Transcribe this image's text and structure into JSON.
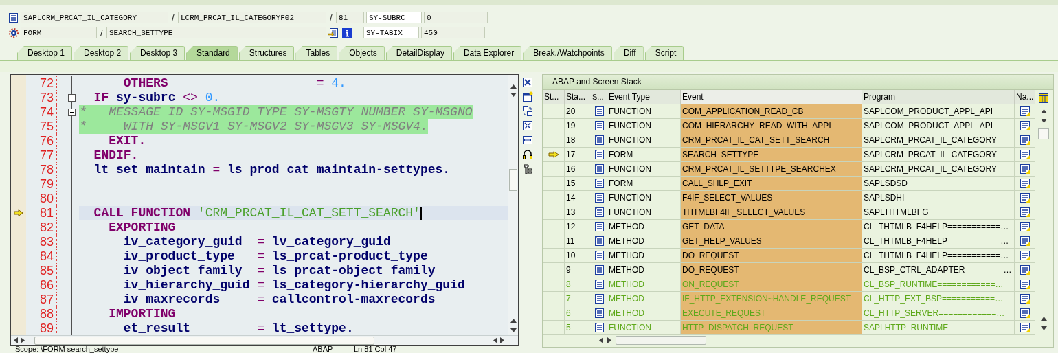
{
  "header": {
    "row1": {
      "program": "SAPLCRM_PRCAT_IL_CATEGORY",
      "separator_1": "/",
      "include": "LCRM_PRCAT_IL_CATEGORYF02",
      "separator_2": "/",
      "line": "81",
      "var_name": "SY-SUBRC",
      "var_value": "0"
    },
    "row2": {
      "event_type": "FORM",
      "separator": "/",
      "event": "SEARCH_SETTYPE",
      "var_name": "SY-TABIX",
      "var_value": "450"
    }
  },
  "tabs": [
    {
      "label": "Desktop 1",
      "selected": false
    },
    {
      "label": "Desktop 2",
      "selected": false
    },
    {
      "label": "Desktop 3",
      "selected": false
    },
    {
      "label": "Standard",
      "selected": true
    },
    {
      "label": "Structures",
      "selected": false
    },
    {
      "label": "Tables",
      "selected": false
    },
    {
      "label": "Objects",
      "selected": false
    },
    {
      "label": "DetailDisplay",
      "selected": false
    },
    {
      "label": "Data Explorer",
      "selected": false
    },
    {
      "label": "Break./Watchpoints",
      "selected": false
    },
    {
      "label": "Diff",
      "selected": false
    },
    {
      "label": "Script",
      "selected": false
    }
  ],
  "editor": {
    "lines": [
      {
        "number": "72",
        "current": false,
        "fold": false,
        "segments": [
          {
            "kind": "kw",
            "text": "      OTHERS"
          },
          {
            "kind": "op",
            "text": "                    = "
          },
          {
            "kind": "num",
            "text": "4."
          }
        ]
      },
      {
        "number": "73",
        "current": false,
        "fold": true,
        "segments": [
          {
            "kind": "kw",
            "text": "  IF"
          },
          {
            "kind": "id",
            "text": " sy-subrc"
          },
          {
            "kind": "op",
            "text": " <> "
          },
          {
            "kind": "num",
            "text": "0."
          }
        ]
      },
      {
        "number": "74",
        "current": false,
        "fold": true,
        "segments": [
          {
            "kind": "cmt",
            "text": "*   MESSAGE ID SY-MSGID TYPE SY-MSGTY NUMBER SY-MSGNO"
          }
        ]
      },
      {
        "number": "75",
        "current": false,
        "fold": false,
        "segments": [
          {
            "kind": "cmt",
            "text": "*     WITH SY-MSGV1 SY-MSGV2 SY-MSGV3 SY-MSGV4."
          }
        ]
      },
      {
        "number": "76",
        "current": false,
        "fold": false,
        "segments": [
          {
            "kind": "kw",
            "text": "    EXIT."
          }
        ]
      },
      {
        "number": "77",
        "current": false,
        "fold": false,
        "segments": [
          {
            "kind": "kw",
            "text": "  ENDIF."
          }
        ]
      },
      {
        "number": "78",
        "current": false,
        "fold": false,
        "segments": [
          {
            "kind": "id",
            "text": "  lt_set_maintain"
          },
          {
            "kind": "op",
            "text": " = "
          },
          {
            "kind": "id",
            "text": "ls_prod_cat_maintain-settypes."
          }
        ]
      },
      {
        "number": "79",
        "current": false,
        "fold": false
      },
      {
        "number": "80",
        "current": false,
        "fold": false
      },
      {
        "number": "81",
        "current": true,
        "fold": false,
        "segments": [
          {
            "kind": "kw",
            "text": "  CALL FUNCTION"
          },
          {
            "kind": "str",
            "text": " 'CRM_PRCAT_IL_CAT_SETT_SEARCH'"
          }
        ]
      },
      {
        "number": "82",
        "current": false,
        "fold": false,
        "segments": [
          {
            "kind": "kw",
            "text": "    EXPORTING"
          }
        ]
      },
      {
        "number": "83",
        "current": false,
        "fold": false,
        "segments": [
          {
            "kind": "id",
            "text": "      iv_category_guid"
          },
          {
            "kind": "op",
            "text": "  = "
          },
          {
            "kind": "id",
            "text": "lv_category_guid"
          }
        ]
      },
      {
        "number": "84",
        "current": false,
        "fold": false,
        "segments": [
          {
            "kind": "id",
            "text": "      iv_product_type"
          },
          {
            "kind": "op",
            "text": "   = "
          },
          {
            "kind": "id",
            "text": "ls_prcat-product_type"
          }
        ]
      },
      {
        "number": "85",
        "current": false,
        "fold": false,
        "segments": [
          {
            "kind": "id",
            "text": "      iv_object_family"
          },
          {
            "kind": "op",
            "text": "  = "
          },
          {
            "kind": "id",
            "text": "ls_prcat-object_family"
          }
        ]
      },
      {
        "number": "86",
        "current": false,
        "fold": false,
        "segments": [
          {
            "kind": "id",
            "text": "      iv_hierarchy_guid"
          },
          {
            "kind": "op",
            "text": " = "
          },
          {
            "kind": "id",
            "text": "ls_category-hierarchy_guid"
          }
        ]
      },
      {
        "number": "87",
        "current": false,
        "fold": false,
        "segments": [
          {
            "kind": "id",
            "text": "      iv_maxrecords"
          },
          {
            "kind": "op",
            "text": "     = "
          },
          {
            "kind": "id",
            "text": "callcontrol-maxrecords"
          }
        ]
      },
      {
        "number": "88",
        "current": false,
        "fold": false,
        "segments": [
          {
            "kind": "kw",
            "text": "    IMPORTING"
          }
        ]
      },
      {
        "number": "89",
        "current": false,
        "fold": false,
        "segments": [
          {
            "kind": "id",
            "text": "      et_result"
          },
          {
            "kind": "op",
            "text": "         = "
          },
          {
            "kind": "id",
            "text": "lt_settype."
          }
        ]
      }
    ]
  },
  "stack": {
    "title": "ABAP and Screen Stack",
    "columns": [
      "St...",
      "Sta...",
      "S...",
      "Event Type",
      "Event",
      "Program",
      "Na..."
    ],
    "rows": [
      {
        "level": "20",
        "event_type": "FUNCTION",
        "event": "COM_APPLICATION_READ_CB",
        "program": "SAPLCOM_PRODUCT_APPL_API",
        "current": false,
        "dimmed": false
      },
      {
        "level": "19",
        "event_type": "FUNCTION",
        "event": "COM_HIERARCHY_READ_WITH_APPL",
        "program": "SAPLCOM_PRODUCT_APPL_API",
        "current": false,
        "dimmed": false
      },
      {
        "level": "18",
        "event_type": "FUNCTION",
        "event": "CRM_PRCAT_IL_CAT_SETT_SEARCH",
        "program": "SAPLCRM_PRCAT_IL_CATEGORY",
        "current": false,
        "dimmed": false
      },
      {
        "level": "17",
        "event_type": "FORM",
        "event": "SEARCH_SETTYPE",
        "program": "SAPLCRM_PRCAT_IL_CATEGORY",
        "current": true,
        "dimmed": false
      },
      {
        "level": "16",
        "event_type": "FUNCTION",
        "event": "CRM_PRCAT_IL_SETTTPE_SEARCHEX",
        "program": "SAPLCRM_PRCAT_IL_CATEGORY",
        "current": false,
        "dimmed": false
      },
      {
        "level": "15",
        "event_type": "FORM",
        "event": "CALL_SHLP_EXIT",
        "program": "SAPLSDSD",
        "current": false,
        "dimmed": false
      },
      {
        "level": "14",
        "event_type": "FUNCTION",
        "event": "F4IF_SELECT_VALUES",
        "program": "SAPLSDHI",
        "current": false,
        "dimmed": false
      },
      {
        "level": "13",
        "event_type": "FUNCTION",
        "event": "THTMLBF4IF_SELECT_VALUES",
        "program": "SAPLTHTMLBFG",
        "current": false,
        "dimmed": false
      },
      {
        "level": "12",
        "event_type": "METHOD",
        "event": "GET_DATA",
        "program": "CL_THTMLB_F4HELP===========…",
        "current": false,
        "dimmed": false
      },
      {
        "level": "11",
        "event_type": "METHOD",
        "event": "GET_HELP_VALUES",
        "program": "CL_THTMLB_F4HELP===========…",
        "current": false,
        "dimmed": false
      },
      {
        "level": "10",
        "event_type": "METHOD",
        "event": "DO_REQUEST",
        "program": "CL_THTMLB_F4HELP===========…",
        "current": false,
        "dimmed": false
      },
      {
        "level": "9",
        "event_type": "METHOD",
        "event": "DO_REQUEST",
        "program": "CL_BSP_CTRL_ADAPTER========…",
        "current": false,
        "dimmed": false
      },
      {
        "level": "8",
        "event_type": "METHOD",
        "event": "ON_REQUEST",
        "program": "CL_BSP_RUNTIME============…",
        "current": false,
        "dimmed": true
      },
      {
        "level": "7",
        "event_type": "METHOD",
        "event": "IF_HTTP_EXTENSION~HANDLE_REQUEST",
        "program": "CL_HTTP_EXT_BSP===========…",
        "current": false,
        "dimmed": true
      },
      {
        "level": "6",
        "event_type": "METHOD",
        "event": "EXECUTE_REQUEST",
        "program": "CL_HTTP_SERVER============…",
        "current": false,
        "dimmed": true
      },
      {
        "level": "5",
        "event_type": "FUNCTION",
        "event": "HTTP_DISPATCH_REQUEST",
        "program": "SAPLHTTP_RUNTIME",
        "current": false,
        "dimmed": true
      }
    ]
  },
  "status_bar": {
    "scope": "Scope: \\FORM search_settype",
    "language": "ABAP",
    "position": "Ln  81 Col  47"
  }
}
